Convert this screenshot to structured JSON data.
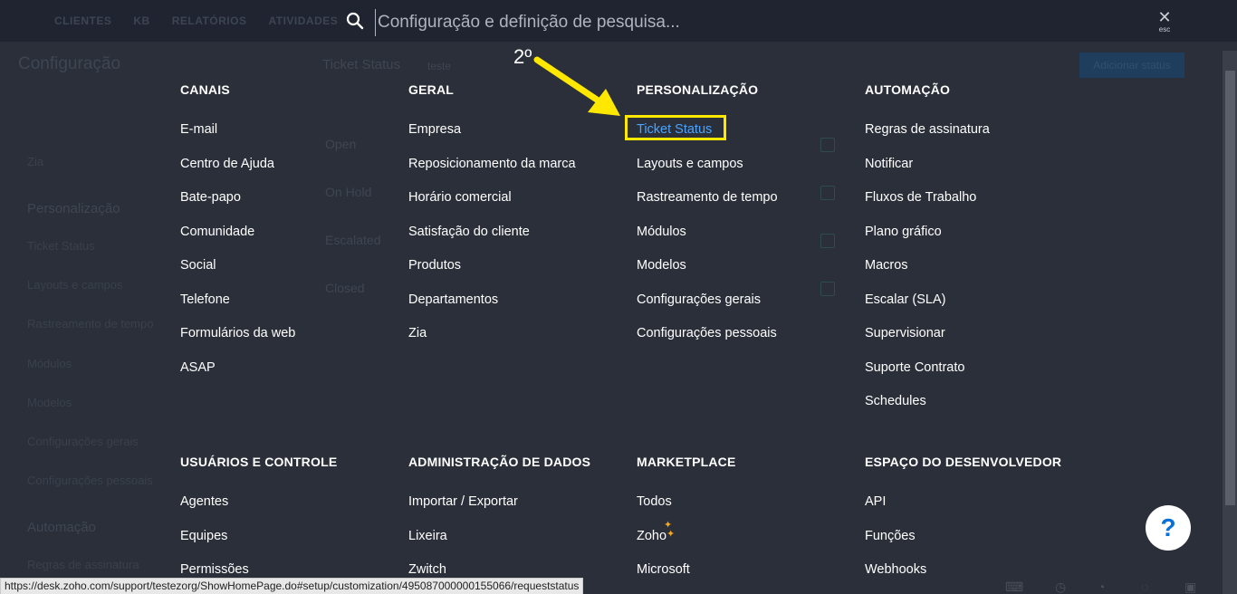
{
  "background": {
    "topnav": [
      "CLIENTES",
      "KB",
      "RELATÓRIOS",
      "ATIVIDADES"
    ],
    "page_title": "Configuração",
    "subtitle": "Ticket Status",
    "sub_dropdown": "teste",
    "add_button": "Adicionar status",
    "sidebar": {
      "zia": "Zia",
      "section_personalizacao": "Personalização",
      "items": [
        "Ticket Status",
        "Layouts e campos",
        "Rastreamento de tempo",
        "Módulos",
        "Modelos",
        "Configurações gerais",
        "Configurações pessoais"
      ],
      "section_automacao": "Automação",
      "last_item": "Regras de assinatura"
    },
    "rows": [
      "Open",
      "On Hold",
      "Escalated",
      "Closed"
    ]
  },
  "search": {
    "placeholder": "Configuração e definição de pesquisa...",
    "esc_label": "esc"
  },
  "annotation": {
    "label": "2º",
    "arrow_color": "#ffe800"
  },
  "menu": {
    "canais": {
      "heading": "CANAIS",
      "items": [
        "E-mail",
        "Centro de Ajuda",
        "Bate-papo",
        "Comunidade",
        "Social",
        "Telefone",
        "Formulários da web",
        "ASAP"
      ]
    },
    "geral": {
      "heading": "GERAL",
      "items": [
        "Empresa",
        "Reposicionamento da marca",
        "Horário comercial",
        "Satisfação do cliente",
        "Produtos",
        "Departamentos",
        "Zia"
      ]
    },
    "personalizacao": {
      "heading": "PERSONALIZAÇÃO",
      "items": [
        "Ticket Status",
        "Layouts e campos",
        "Rastreamento de tempo",
        "Módulos",
        "Modelos",
        "Configurações gerais",
        "Configurações pessoais"
      ]
    },
    "automacao": {
      "heading": "AUTOMAÇÃO",
      "items": [
        "Regras de assinatura",
        "Notificar",
        "Fluxos de Trabalho",
        "Plano gráfico",
        "Macros",
        "Escalar (SLA)",
        "Supervisionar",
        "Suporte Contrato",
        "Schedules"
      ]
    },
    "usuarios": {
      "heading": "USUÁRIOS E CONTROLE",
      "items": [
        "Agentes",
        "Equipes",
        "Permissões"
      ]
    },
    "administracao": {
      "heading": "ADMINISTRAÇÃO DE DADOS",
      "items": [
        "Importar / Exportar",
        "Lixeira",
        "Zwitch"
      ]
    },
    "marketplace": {
      "heading": "MARKETPLACE",
      "items": [
        "Todos",
        "Zoho",
        "Microsoft"
      ]
    },
    "desenvolvedor": {
      "heading": "ESPAÇO DO DESENVOLVEDOR",
      "items": [
        "API",
        "Funções",
        "Webhooks"
      ]
    }
  },
  "help": {
    "label": "?"
  },
  "statusbar": {
    "url": "https://desk.zoho.com/support/testezorg/ShowHomePage.do#setup/customization/495087000000155066/requeststatus"
  },
  "colors": {
    "overlay_bg": "#2a2f39",
    "active_link": "#4aa3ff",
    "highlight": "#ffe800"
  }
}
